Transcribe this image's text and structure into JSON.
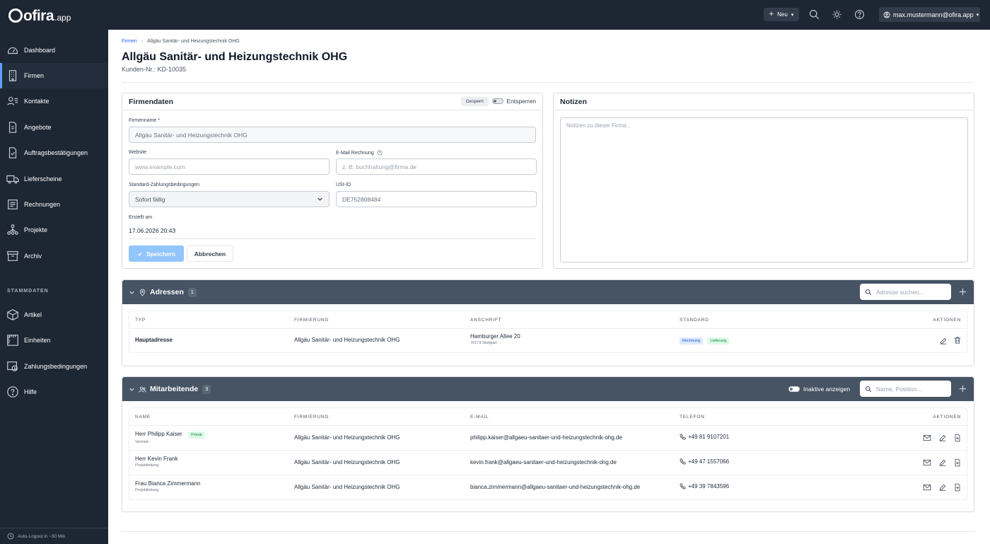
{
  "app": {
    "brand": "ofira",
    "brand_tld": ".app"
  },
  "topbar": {
    "new_label": "Neu",
    "user_email": "max.mustermann@ofira.app"
  },
  "sidebar": {
    "items": [
      {
        "label": "Dashboard",
        "icon": "dashboard-icon"
      },
      {
        "label": "Firmen",
        "icon": "building-icon"
      },
      {
        "label": "Kontakte",
        "icon": "contacts-icon"
      },
      {
        "label": "Angebote",
        "icon": "document-icon"
      },
      {
        "label": "Auftragsbestätigungen",
        "icon": "document-check-icon"
      },
      {
        "label": "Lieferscheine",
        "icon": "truck-icon"
      },
      {
        "label": "Rechnungen",
        "icon": "invoice-icon"
      },
      {
        "label": "Projekte",
        "icon": "project-icon"
      },
      {
        "label": "Archiv",
        "icon": "archive-icon"
      }
    ],
    "section_label": "STAMMDATEN",
    "master_items": [
      {
        "label": "Artikel",
        "icon": "box-icon"
      },
      {
        "label": "Einheiten",
        "icon": "ruler-icon"
      },
      {
        "label": "Zahlungsbedingungen",
        "icon": "payment-icon"
      },
      {
        "label": "Hilfe",
        "icon": "help-icon"
      }
    ],
    "footer": "Auto-Logout in ~30 Min"
  },
  "breadcrumb": {
    "parent": "Firmen",
    "current": "Allgäu Sanitär- und Heizungstechnik OHG"
  },
  "page": {
    "title": "Allgäu Sanitär- und Heizungstechnik OHG",
    "subtitle": "Kunden-Nr.: KD-10035"
  },
  "firmendaten": {
    "title": "Firmendaten",
    "locked_badge": "Gesperrt",
    "unlock_label": "Entsperren",
    "name_label": "Firmenname *",
    "name_value": "Allgäu Sanitär- und Heizungstechnik OHG",
    "website_label": "Website",
    "website_placeholder": "www.example.com",
    "email_label": "E-Mail Rechnung",
    "email_placeholder": "z. B. buchhaltung@firma.de",
    "payment_label": "Standard-Zahlungsbedingungen",
    "payment_value": "Sofort fällig",
    "vat_label": "USt-ID",
    "vat_value": "DE752808484",
    "created_label": "Erstellt am",
    "created_value": "17.06.2026 20:43",
    "save_label": "Speichern",
    "cancel_label": "Abbrechen"
  },
  "notizen": {
    "title": "Notizen",
    "placeholder": "Notizen zu dieser Firma..."
  },
  "adressen": {
    "title": "Adressen",
    "count": "1",
    "search_placeholder": "Adresse suchen...",
    "columns": [
      "TYP",
      "FIRMIERUNG",
      "ANSCHRIFT",
      "STANDARD",
      "AKTIONEN"
    ],
    "rows": [
      {
        "type": "Hauptadresse",
        "company": "Allgäu Sanitär- und Heizungstechnik OHG",
        "street": "Hamburger Allee 20",
        "city": "70173 Stuttgart",
        "tags": [
          "Rechnung",
          "Lieferung"
        ]
      }
    ]
  },
  "mitarbeitende": {
    "title": "Mitarbeitende",
    "count": "3",
    "inactive_label": "Inaktive anzeigen",
    "search_placeholder": "Name, Position...",
    "columns": [
      "NAME",
      "FIRMIERUNG",
      "E-MAIL",
      "TELEFON",
      "AKTIONEN"
    ],
    "rows": [
      {
        "name": "Herr Philipp Kaiser",
        "badge": "Primär",
        "role": "Vertrieb",
        "company": "Allgäu Sanitär- und Heizungstechnik OHG",
        "email": "philipp.kaiser@allgaeu-sanitaer-und-heizungstechnik-ohg.de",
        "phone": "+49 81 9107201"
      },
      {
        "name": "Herr Kevin Frank",
        "badge": "",
        "role": "Projektleitung",
        "company": "Allgäu Sanitär- und Heizungstechnik OHG",
        "email": "kevin.frank@allgaeu-sanitaer-und-heizungstechnik-ohg.de",
        "phone": "+49 47 1557066"
      },
      {
        "name": "Frau Bianca Zimmermann",
        "badge": "",
        "role": "Projektleitung",
        "company": "Allgäu Sanitär- und Heizungstechnik OHG",
        "email": "bianca.zimmermann@allgaeu-sanitaer-und-heizungstechnik-ohg.de",
        "phone": "+49 39 7843596"
      }
    ]
  },
  "colors": {
    "sidebar_bg": "#1d2633",
    "accent": "#5ea0ff",
    "section_header": "#465464",
    "save_button": "#93c5fd"
  }
}
